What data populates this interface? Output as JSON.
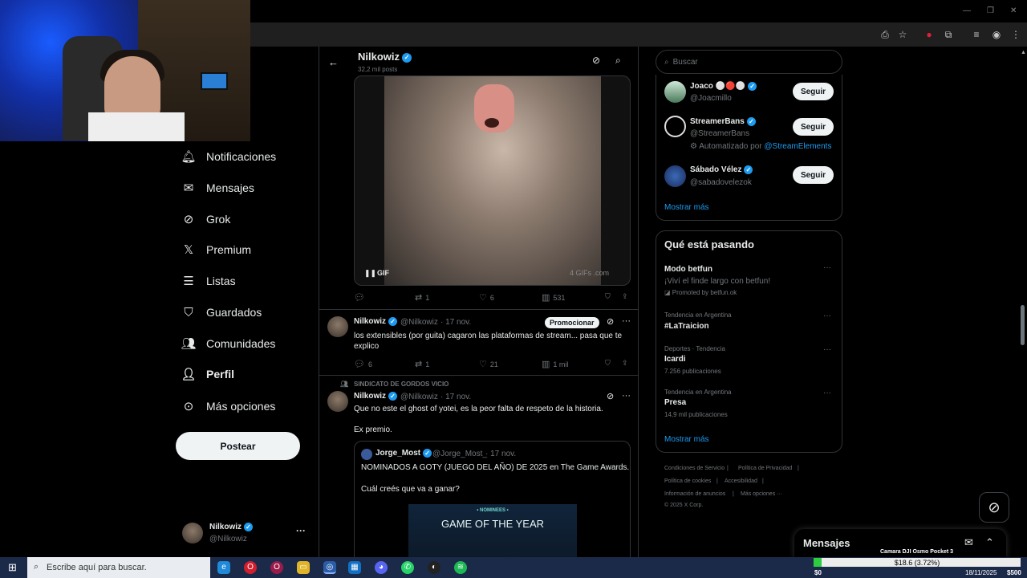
{
  "webcam": {
    "label": "streamer webcam"
  },
  "sidebar": {
    "items": [
      {
        "label": "Notificaciones",
        "icon": "bell-icon"
      },
      {
        "label": "Mensajes",
        "icon": "mail-icon"
      },
      {
        "label": "Grok",
        "icon": "grok-icon"
      },
      {
        "label": "Premium",
        "icon": "x-logo-icon"
      },
      {
        "label": "Listas",
        "icon": "list-icon"
      },
      {
        "label": "Guardados",
        "icon": "bookmark-icon"
      },
      {
        "label": "Comunidades",
        "icon": "people-icon"
      },
      {
        "label": "Perfil",
        "icon": "person-icon"
      },
      {
        "label": "Más opciones",
        "icon": "more-circle-icon"
      }
    ],
    "post_button": "Postear",
    "profile": {
      "name": "Nilkowiz",
      "handle": "@Nilkowiz",
      "more": "···"
    }
  },
  "header": {
    "name": "Nilkowiz",
    "posts": "32,2 mil posts"
  },
  "tweet1": {
    "gif_badge": "GIF",
    "watermark": "4 GIFs .com",
    "replies": "",
    "retweets": "1",
    "likes": "6",
    "views": "531"
  },
  "tweet2": {
    "name": "Nilkowiz",
    "handle": "@Nilkowiz",
    "date": "· 17 nov.",
    "promote": "Promocionar",
    "text": "los extensibles (por guita) cagaron las plataformas de stream... pasa que te explico",
    "replies": "6",
    "retweets": "1",
    "likes": "21",
    "views": "1 mil"
  },
  "tweet3": {
    "community": "SINDICATO DE GORDOS VICIO",
    "name": "Nilkowiz",
    "handle": "@Nilkowiz",
    "date": "· 17 nov.",
    "text1": "Que no este el ghost of yotei, es la peor falta de respeto de la historia.",
    "text2": "Ex premio.",
    "quote": {
      "name": "Jorge_Most",
      "handle": "@Jorge_Most_",
      "date": "· 17 nov.",
      "text1": "NOMINADOS A GOTY (JUEGO DEL AÑO) DE 2025 en The Game Awards.",
      "text2": "Cuál creés que va a ganar?",
      "image_small": "• NOMINEES •",
      "image_big": "GAME OF THE YEAR"
    }
  },
  "search": {
    "placeholder": "Buscar"
  },
  "suggestions": [
    {
      "name": "Joaco ⚪🔴⚪",
      "handle": "@Joacmillo",
      "button": "Seguir"
    },
    {
      "name": "StreamerBans",
      "handle": "@StreamerBans",
      "button": "Seguir",
      "note_prefix": "Automatizado por ",
      "note_link": "@StreamElements"
    },
    {
      "name": "Sábado Vélez",
      "handle": "@sabadovelezok",
      "button": "Seguir"
    }
  ],
  "show_more": "Mostrar más",
  "trends": {
    "title": "Qué está pasando",
    "items": [
      {
        "context": "",
        "name": "Modo betfun",
        "sub": "¡Viví el finde largo con betfun!",
        "sub2": "Promoted by betfun.ok"
      },
      {
        "context": "Tendencia en Argentina",
        "name": "#LaTraicion",
        "sub": ""
      },
      {
        "context": "Deportes · Tendencia",
        "name": "Icardi",
        "sub": "7.256 publicaciones"
      },
      {
        "context": "Tendencia en Argentina",
        "name": "Presa",
        "sub": "14,9 mil publicaciones"
      }
    ],
    "more_label": "···",
    "show_more": "Mostrar más"
  },
  "footer": {
    "links": [
      "Condiciones de Servicio",
      "Política de Privacidad",
      "Política de cookies",
      "Accesibilidad",
      "Información de anuncios",
      "Más opciones ···"
    ],
    "copyright": "© 2025 X Corp."
  },
  "messages": {
    "title": "Mensajes"
  },
  "overlay": {
    "camera": "Camara DJI Osmo Pocket 3",
    "amount": "$18.6 (3.72%)",
    "progress_fraction": 0.0372,
    "start": "$0",
    "goal": "$500"
  },
  "taskbar": {
    "search_placeholder": "Escribe aquí para buscar.",
    "date": "18/11/2025"
  },
  "colors": {
    "accent": "#1d9bf0",
    "background": "#000000",
    "taskbar": "#1c2a4a"
  }
}
